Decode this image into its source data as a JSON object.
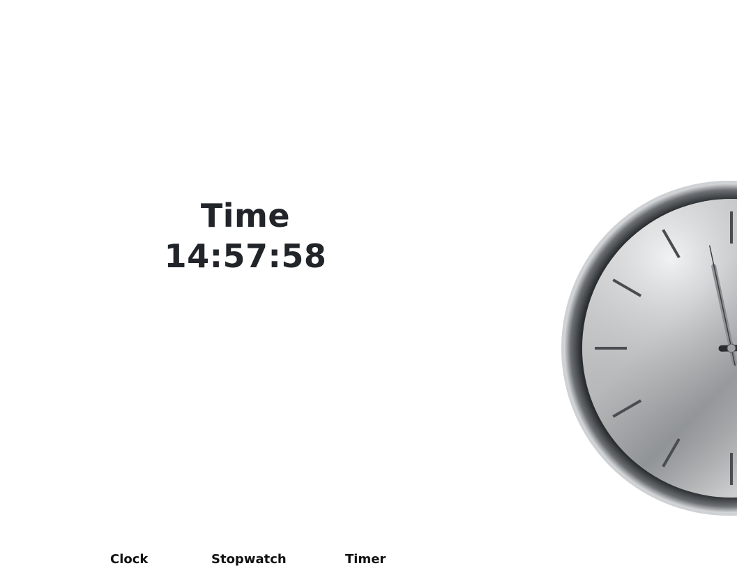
{
  "time_panel": {
    "title": "Time",
    "value": "14:57:58"
  },
  "nav": {
    "items": [
      {
        "label": "Clock"
      },
      {
        "label": "Stopwatch"
      },
      {
        "label": "Timer"
      }
    ]
  },
  "clock_image": {
    "hour": 14,
    "minute": 57,
    "second": 58,
    "face_color": "#c9ccce",
    "rim_color": "#3a3d40"
  }
}
